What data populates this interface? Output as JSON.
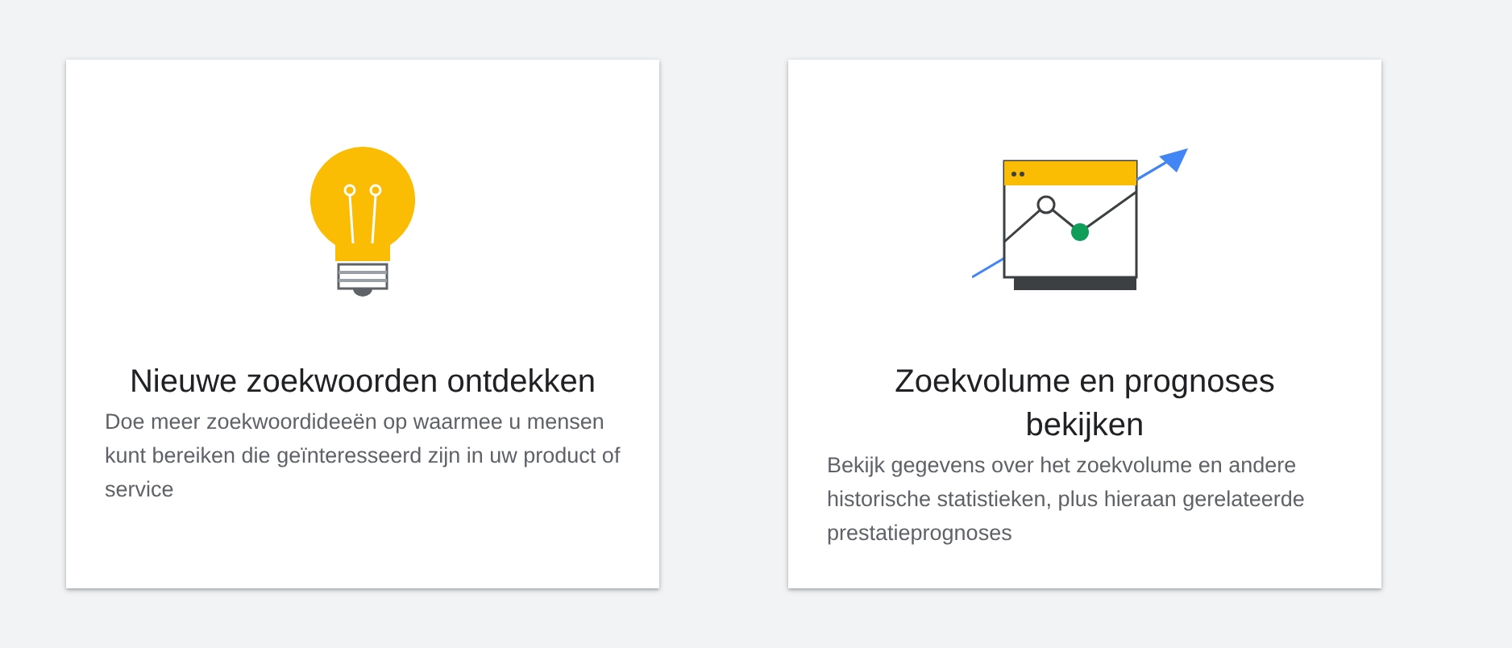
{
  "cards": [
    {
      "kind": "bulb",
      "title": "Nieuwe zoekwoorden ontdekken",
      "description": "Doe meer zoekwoordideeën op waarmee u mensen kunt bereiken die geïnteresseerd zijn in uw product of service"
    },
    {
      "kind": "chart",
      "title": "Zoekvolume en prognoses bekijken",
      "description": "Bekijk gegevens over het zoekvolume en andere historische statistieken, plus hieraan gerelateerde prestatieprognoses"
    }
  ]
}
